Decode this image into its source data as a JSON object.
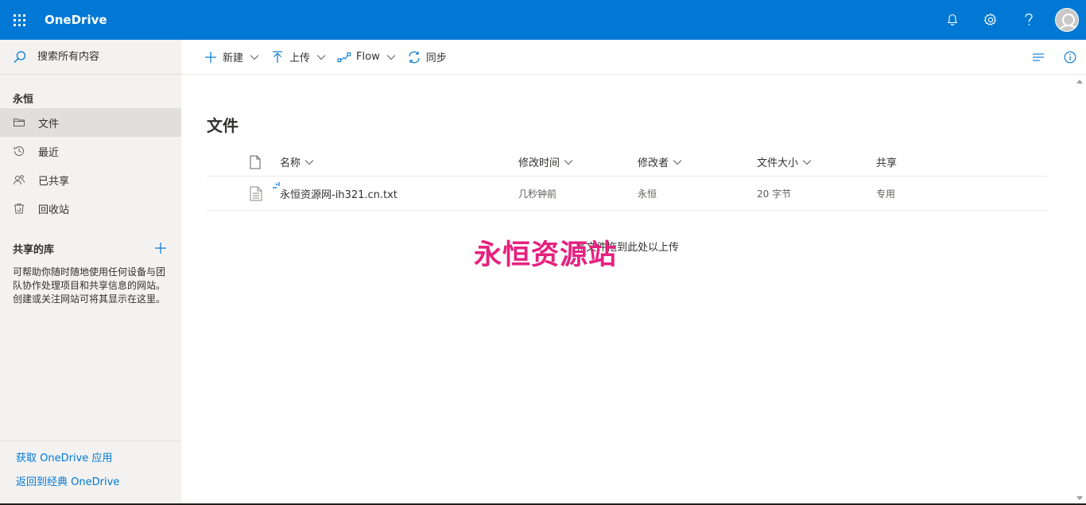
{
  "suite": {
    "app_name": "OneDrive",
    "icons": [
      "waffle-icon",
      "bell-icon",
      "gear-icon",
      "help-icon",
      "avatar"
    ]
  },
  "colors": {
    "accent": "#0078d4",
    "watermark": "#e6217f",
    "nav_bg": "#f3f2f1"
  },
  "search": {
    "placeholder": "搜索所有内容"
  },
  "nav": {
    "group_title": "永恒",
    "items": [
      {
        "label": "文件",
        "icon": "folder-icon",
        "selected": true
      },
      {
        "label": "最近",
        "icon": "recent-icon",
        "selected": false
      },
      {
        "label": "已共享",
        "icon": "shared-icon",
        "selected": false
      },
      {
        "label": "回收站",
        "icon": "recycle-bin-icon",
        "selected": false
      }
    ],
    "libraries_title": "共享的库",
    "libraries_desc": "可帮助你随时随地使用任何设备与团队协作处理项目和共享信息的网站。创建或关注网站可将其显示在这里。",
    "footer_links": [
      "获取 OneDrive 应用",
      "返回到经典 OneDrive"
    ]
  },
  "commands": {
    "new": "新建",
    "upload": "上传",
    "flow": "Flow",
    "sync": "同步"
  },
  "main": {
    "title": "文件",
    "columns": {
      "name": "名称",
      "modified": "修改时间",
      "modified_by": "修改者",
      "size": "文件大小",
      "sharing": "共享"
    },
    "rows": [
      {
        "name": "永恒资源网-ih321.cn.txt",
        "modified": "几秒钟前",
        "modified_by": "永恒",
        "size": "20 字节",
        "sharing": "专用"
      }
    ],
    "drop_hint": "将文件拖到此处以上传",
    "watermark": "永恒资源站"
  }
}
